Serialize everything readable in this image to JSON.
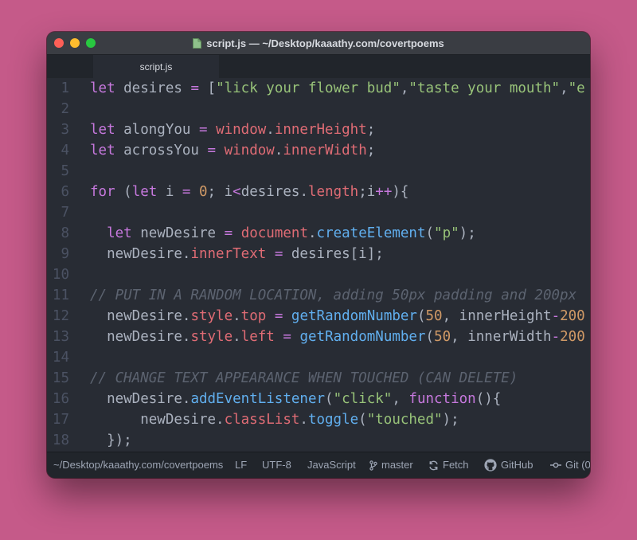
{
  "window": {
    "title": "script.js — ~/Desktop/kaaathy.com/covertpoems",
    "tab_label": "script.js"
  },
  "editor": {
    "lines": [
      {
        "n": "1",
        "tokens": [
          [
            "let",
            "kw"
          ],
          [
            " desires ",
            ""
          ],
          [
            "=",
            "kw"
          ],
          [
            " [",
            ""
          ],
          [
            "\"lick your flower bud\"",
            "str"
          ],
          [
            ",",
            ""
          ],
          [
            "\"taste your mouth\"",
            "str"
          ],
          [
            ",",
            ""
          ],
          [
            "\"e",
            "str"
          ]
        ]
      },
      {
        "n": "2",
        "tokens": []
      },
      {
        "n": "3",
        "tokens": [
          [
            "let",
            "kw"
          ],
          [
            " alongYou ",
            ""
          ],
          [
            "=",
            "kw"
          ],
          [
            " ",
            ""
          ],
          [
            "window",
            "var"
          ],
          [
            ".",
            ""
          ],
          [
            "innerHeight",
            "var"
          ],
          [
            ";",
            ""
          ]
        ]
      },
      {
        "n": "4",
        "tokens": [
          [
            "let",
            "kw"
          ],
          [
            " acrossYou ",
            ""
          ],
          [
            "=",
            "kw"
          ],
          [
            " ",
            ""
          ],
          [
            "window",
            "var"
          ],
          [
            ".",
            ""
          ],
          [
            "innerWidth",
            "var"
          ],
          [
            ";",
            ""
          ]
        ]
      },
      {
        "n": "5",
        "tokens": []
      },
      {
        "n": "6",
        "tokens": [
          [
            "for",
            "kw"
          ],
          [
            " (",
            ""
          ],
          [
            "let",
            "kw"
          ],
          [
            " i ",
            ""
          ],
          [
            "=",
            "kw"
          ],
          [
            " ",
            ""
          ],
          [
            "0",
            "num"
          ],
          [
            "; i",
            ""
          ],
          [
            "<",
            "kw"
          ],
          [
            "desires.",
            ""
          ],
          [
            "length",
            "var"
          ],
          [
            ";i",
            ""
          ],
          [
            "++",
            "kw"
          ],
          [
            "){",
            ""
          ]
        ]
      },
      {
        "n": "7",
        "tokens": []
      },
      {
        "n": "8",
        "tokens": [
          [
            "  ",
            ""
          ],
          [
            "let",
            "kw"
          ],
          [
            " newDesire ",
            ""
          ],
          [
            "=",
            "kw"
          ],
          [
            " ",
            ""
          ],
          [
            "document",
            "var"
          ],
          [
            ".",
            ""
          ],
          [
            "createElement",
            "fn"
          ],
          [
            "(",
            ""
          ],
          [
            "\"p\"",
            "str"
          ],
          [
            ");",
            ""
          ]
        ]
      },
      {
        "n": "9",
        "tokens": [
          [
            "  newDesire.",
            ""
          ],
          [
            "innerText",
            "var"
          ],
          [
            " ",
            ""
          ],
          [
            "=",
            "kw"
          ],
          [
            " desires[i];",
            ""
          ]
        ]
      },
      {
        "n": "10",
        "tokens": []
      },
      {
        "n": "11",
        "tokens": [
          [
            "// PUT IN A RANDOM LOCATION, adding 50px padding and 200px",
            "cm"
          ]
        ]
      },
      {
        "n": "12",
        "tokens": [
          [
            "  newDesire.",
            ""
          ],
          [
            "style",
            "var"
          ],
          [
            ".",
            ""
          ],
          [
            "top",
            "var"
          ],
          [
            " ",
            ""
          ],
          [
            "=",
            "kw"
          ],
          [
            " ",
            ""
          ],
          [
            "getRandomNumber",
            "fn"
          ],
          [
            "(",
            ""
          ],
          [
            "50",
            "num"
          ],
          [
            ", innerHeight",
            ""
          ],
          [
            "-",
            "kw"
          ],
          [
            "200",
            "num"
          ]
        ]
      },
      {
        "n": "13",
        "tokens": [
          [
            "  newDesire.",
            ""
          ],
          [
            "style",
            "var"
          ],
          [
            ".",
            ""
          ],
          [
            "left",
            "var"
          ],
          [
            " ",
            ""
          ],
          [
            "=",
            "kw"
          ],
          [
            " ",
            ""
          ],
          [
            "getRandomNumber",
            "fn"
          ],
          [
            "(",
            ""
          ],
          [
            "50",
            "num"
          ],
          [
            ", innerWidth",
            ""
          ],
          [
            "-",
            "kw"
          ],
          [
            "200",
            "num"
          ]
        ]
      },
      {
        "n": "14",
        "tokens": []
      },
      {
        "n": "15",
        "tokens": [
          [
            "// CHANGE TEXT APPEARANCE WHEN TOUCHED (CAN DELETE)",
            "cm"
          ]
        ]
      },
      {
        "n": "16",
        "tokens": [
          [
            "  newDesire.",
            ""
          ],
          [
            "addEventListener",
            "fn"
          ],
          [
            "(",
            ""
          ],
          [
            "\"click\"",
            "str"
          ],
          [
            ", ",
            ""
          ],
          [
            "function",
            "kw"
          ],
          [
            "(){",
            ""
          ]
        ]
      },
      {
        "n": "17",
        "tokens": [
          [
            "      newDesire.",
            ""
          ],
          [
            "classList",
            "var"
          ],
          [
            ".",
            ""
          ],
          [
            "toggle",
            "fn"
          ],
          [
            "(",
            ""
          ],
          [
            "\"touched\"",
            "str"
          ],
          [
            ");",
            ""
          ]
        ]
      },
      {
        "n": "18",
        "tokens": [
          [
            "  });",
            ""
          ]
        ]
      }
    ]
  },
  "status": {
    "path": "~/Desktop/kaaathy.com/covertpoems",
    "line_ending": "LF",
    "encoding": "UTF-8",
    "grammar": "JavaScript",
    "branch": "master",
    "fetch": "Fetch",
    "github": "GitHub",
    "git": "Git (0"
  },
  "colors": {
    "background": "#c55a89",
    "keyword": "#c678dd",
    "string": "#98c379",
    "number": "#d19a66",
    "variable": "#e06c75",
    "function": "#61afef",
    "comment": "#5c6370",
    "text": "#abb2bf"
  }
}
